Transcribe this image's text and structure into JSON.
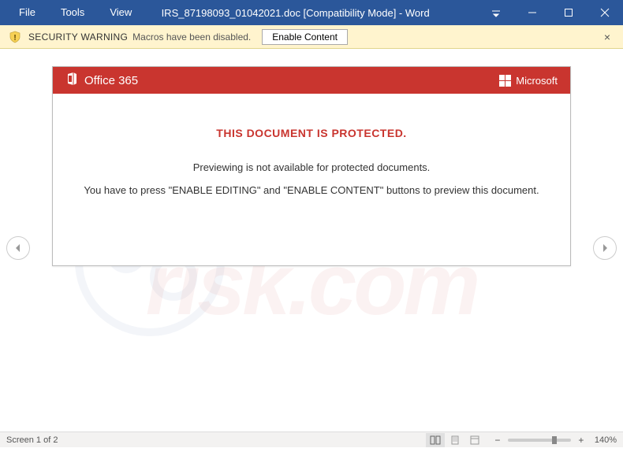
{
  "titlebar": {
    "menus": [
      "File",
      "Tools",
      "View"
    ],
    "doc_title": "IRS_87198093_01042021.doc [Compatibility Mode] - Word"
  },
  "warning": {
    "label": "SECURITY WARNING",
    "message": "Macros have been disabled.",
    "enable_button": "Enable Content"
  },
  "document": {
    "brand_label": "Office 365",
    "ms_label": "Microsoft",
    "protected_title": "THIS DOCUMENT IS PROTECTED.",
    "line1": "Previewing is not available for protected documents.",
    "line2": "You have to press \"ENABLE EDITING\" and \"ENABLE CONTENT\" buttons to preview this document."
  },
  "status": {
    "screen_text": "Screen 1 of 2",
    "zoom_percent": "140%"
  },
  "watermark": {
    "line1": "PC",
    "line2": "risk.com"
  }
}
